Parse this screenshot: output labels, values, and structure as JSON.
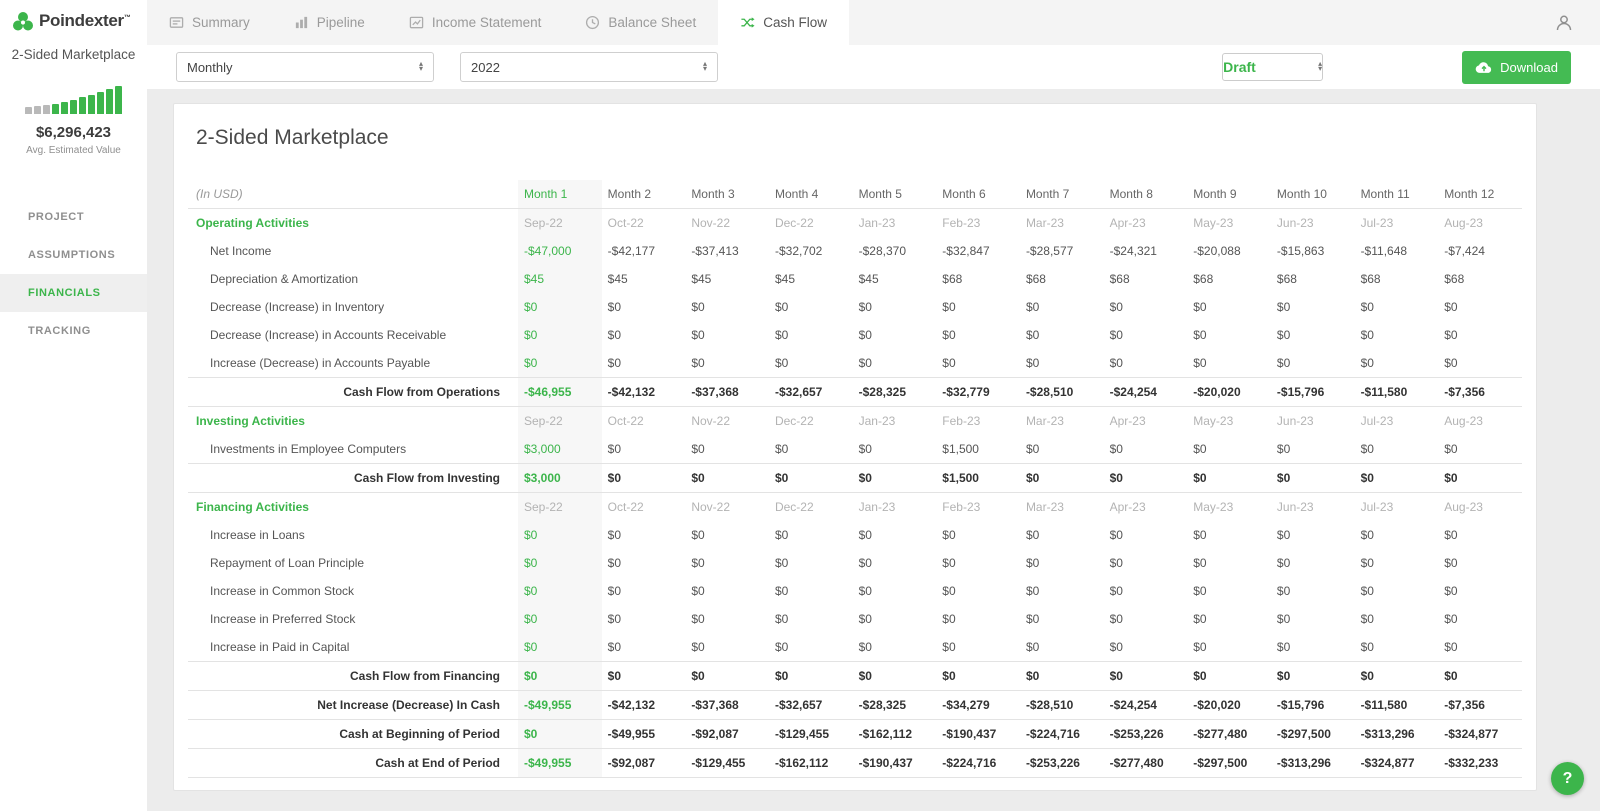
{
  "accent": "#3cb54b",
  "app": {
    "logo_text": "Poindexter",
    "logo_tm": "™"
  },
  "sidebar": {
    "project_name": "2-Sided Marketplace",
    "estimated_value": "$6,296,423",
    "estimated_caption": "Avg. Estimated Value",
    "sparkline": {
      "bars": [
        7,
        8,
        9,
        10,
        12,
        14,
        17,
        19,
        22,
        25,
        28
      ],
      "gray_bars": 3
    },
    "items": [
      {
        "label": "PROJECT",
        "active": false
      },
      {
        "label": "ASSUMPTIONS",
        "active": false
      },
      {
        "label": "FINANCIALS",
        "active": true
      },
      {
        "label": "TRACKING",
        "active": false
      }
    ]
  },
  "tabs": [
    {
      "label": "Summary",
      "icon": "summary-icon",
      "active": false
    },
    {
      "label": "Pipeline",
      "icon": "pipeline-icon",
      "active": false
    },
    {
      "label": "Income Statement",
      "icon": "income-statement-icon",
      "active": false
    },
    {
      "label": "Balance Sheet",
      "icon": "balance-sheet-icon",
      "active": false
    },
    {
      "label": "Cash Flow",
      "icon": "cash-flow-icon",
      "active": true
    }
  ],
  "toolbar": {
    "period_select": "Monthly",
    "year_select": "2022",
    "status_select": "Draft",
    "download_label": "Download"
  },
  "page": {
    "title": "2-Sided Marketplace"
  },
  "help": {
    "label": "?"
  },
  "table": {
    "unit_label": "(In USD)",
    "columns": [
      "Month 1",
      "Month 2",
      "Month 3",
      "Month 4",
      "Month 5",
      "Month 6",
      "Month 7",
      "Month 8",
      "Month 9",
      "Month 10",
      "Month 11",
      "Month 12"
    ],
    "rows": [
      {
        "type": "section",
        "label": "Operating Activities",
        "values": [
          "Sep-22",
          "Oct-22",
          "Nov-22",
          "Dec-22",
          "Jan-23",
          "Feb-23",
          "Mar-23",
          "Apr-23",
          "May-23",
          "Jun-23",
          "Jul-23",
          "Aug-23"
        ]
      },
      {
        "type": "item",
        "label": "Net Income",
        "values": [
          "-$47,000",
          "-$42,177",
          "-$37,413",
          "-$32,702",
          "-$28,370",
          "-$32,847",
          "-$28,577",
          "-$24,321",
          "-$20,088",
          "-$15,863",
          "-$11,648",
          "-$7,424"
        ]
      },
      {
        "type": "item",
        "label": "Depreciation & Amortization",
        "values": [
          "$45",
          "$45",
          "$45",
          "$45",
          "$45",
          "$68",
          "$68",
          "$68",
          "$68",
          "$68",
          "$68",
          "$68"
        ]
      },
      {
        "type": "item",
        "label": "Decrease (Increase) in Inventory",
        "values": [
          "$0",
          "$0",
          "$0",
          "$0",
          "$0",
          "$0",
          "$0",
          "$0",
          "$0",
          "$0",
          "$0",
          "$0"
        ]
      },
      {
        "type": "item",
        "label": "Decrease (Increase) in Accounts Receivable",
        "values": [
          "$0",
          "$0",
          "$0",
          "$0",
          "$0",
          "$0",
          "$0",
          "$0",
          "$0",
          "$0",
          "$0",
          "$0"
        ]
      },
      {
        "type": "item",
        "label": "Increase (Decrease) in Accounts Payable",
        "values": [
          "$0",
          "$0",
          "$0",
          "$0",
          "$0",
          "$0",
          "$0",
          "$0",
          "$0",
          "$0",
          "$0",
          "$0"
        ]
      },
      {
        "type": "total",
        "label": "Cash Flow from Operations",
        "values": [
          "-$46,955",
          "-$42,132",
          "-$37,368",
          "-$32,657",
          "-$28,325",
          "-$32,779",
          "-$28,510",
          "-$24,254",
          "-$20,020",
          "-$15,796",
          "-$11,580",
          "-$7,356"
        ]
      },
      {
        "type": "section",
        "label": "Investing Activities",
        "values": [
          "Sep-22",
          "Oct-22",
          "Nov-22",
          "Dec-22",
          "Jan-23",
          "Feb-23",
          "Mar-23",
          "Apr-23",
          "May-23",
          "Jun-23",
          "Jul-23",
          "Aug-23"
        ]
      },
      {
        "type": "item",
        "label": "Investments in Employee Computers",
        "values": [
          "$3,000",
          "$0",
          "$0",
          "$0",
          "$0",
          "$1,500",
          "$0",
          "$0",
          "$0",
          "$0",
          "$0",
          "$0"
        ]
      },
      {
        "type": "total",
        "label": "Cash Flow from Investing",
        "values": [
          "$3,000",
          "$0",
          "$0",
          "$0",
          "$0",
          "$1,500",
          "$0",
          "$0",
          "$0",
          "$0",
          "$0",
          "$0"
        ]
      },
      {
        "type": "section",
        "label": "Financing Activities",
        "values": [
          "Sep-22",
          "Oct-22",
          "Nov-22",
          "Dec-22",
          "Jan-23",
          "Feb-23",
          "Mar-23",
          "Apr-23",
          "May-23",
          "Jun-23",
          "Jul-23",
          "Aug-23"
        ]
      },
      {
        "type": "item",
        "label": "Increase in Loans",
        "values": [
          "$0",
          "$0",
          "$0",
          "$0",
          "$0",
          "$0",
          "$0",
          "$0",
          "$0",
          "$0",
          "$0",
          "$0"
        ]
      },
      {
        "type": "item",
        "label": "Repayment of Loan Principle",
        "values": [
          "$0",
          "$0",
          "$0",
          "$0",
          "$0",
          "$0",
          "$0",
          "$0",
          "$0",
          "$0",
          "$0",
          "$0"
        ]
      },
      {
        "type": "item",
        "label": "Increase in Common Stock",
        "values": [
          "$0",
          "$0",
          "$0",
          "$0",
          "$0",
          "$0",
          "$0",
          "$0",
          "$0",
          "$0",
          "$0",
          "$0"
        ]
      },
      {
        "type": "item",
        "label": "Increase in Preferred Stock",
        "values": [
          "$0",
          "$0",
          "$0",
          "$0",
          "$0",
          "$0",
          "$0",
          "$0",
          "$0",
          "$0",
          "$0",
          "$0"
        ]
      },
      {
        "type": "item",
        "label": "Increase in Paid in Capital",
        "values": [
          "$0",
          "$0",
          "$0",
          "$0",
          "$0",
          "$0",
          "$0",
          "$0",
          "$0",
          "$0",
          "$0",
          "$0"
        ]
      },
      {
        "type": "total",
        "label": "Cash Flow from Financing",
        "values": [
          "$0",
          "$0",
          "$0",
          "$0",
          "$0",
          "$0",
          "$0",
          "$0",
          "$0",
          "$0",
          "$0",
          "$0"
        ]
      },
      {
        "type": "total",
        "label": "Net Increase (Decrease) In Cash",
        "values": [
          "-$49,955",
          "-$42,132",
          "-$37,368",
          "-$32,657",
          "-$28,325",
          "-$34,279",
          "-$28,510",
          "-$24,254",
          "-$20,020",
          "-$15,796",
          "-$11,580",
          "-$7,356"
        ]
      },
      {
        "type": "total",
        "label": "Cash at Beginning of Period",
        "values": [
          "$0",
          "-$49,955",
          "-$92,087",
          "-$129,455",
          "-$162,112",
          "-$190,437",
          "-$224,716",
          "-$253,226",
          "-$277,480",
          "-$297,500",
          "-$313,296",
          "-$324,877"
        ]
      },
      {
        "type": "total",
        "label": "Cash at End of Period",
        "values": [
          "-$49,955",
          "-$92,087",
          "-$129,455",
          "-$162,112",
          "-$190,437",
          "-$224,716",
          "-$253,226",
          "-$277,480",
          "-$297,500",
          "-$313,296",
          "-$324,877",
          "-$332,233"
        ]
      }
    ]
  }
}
